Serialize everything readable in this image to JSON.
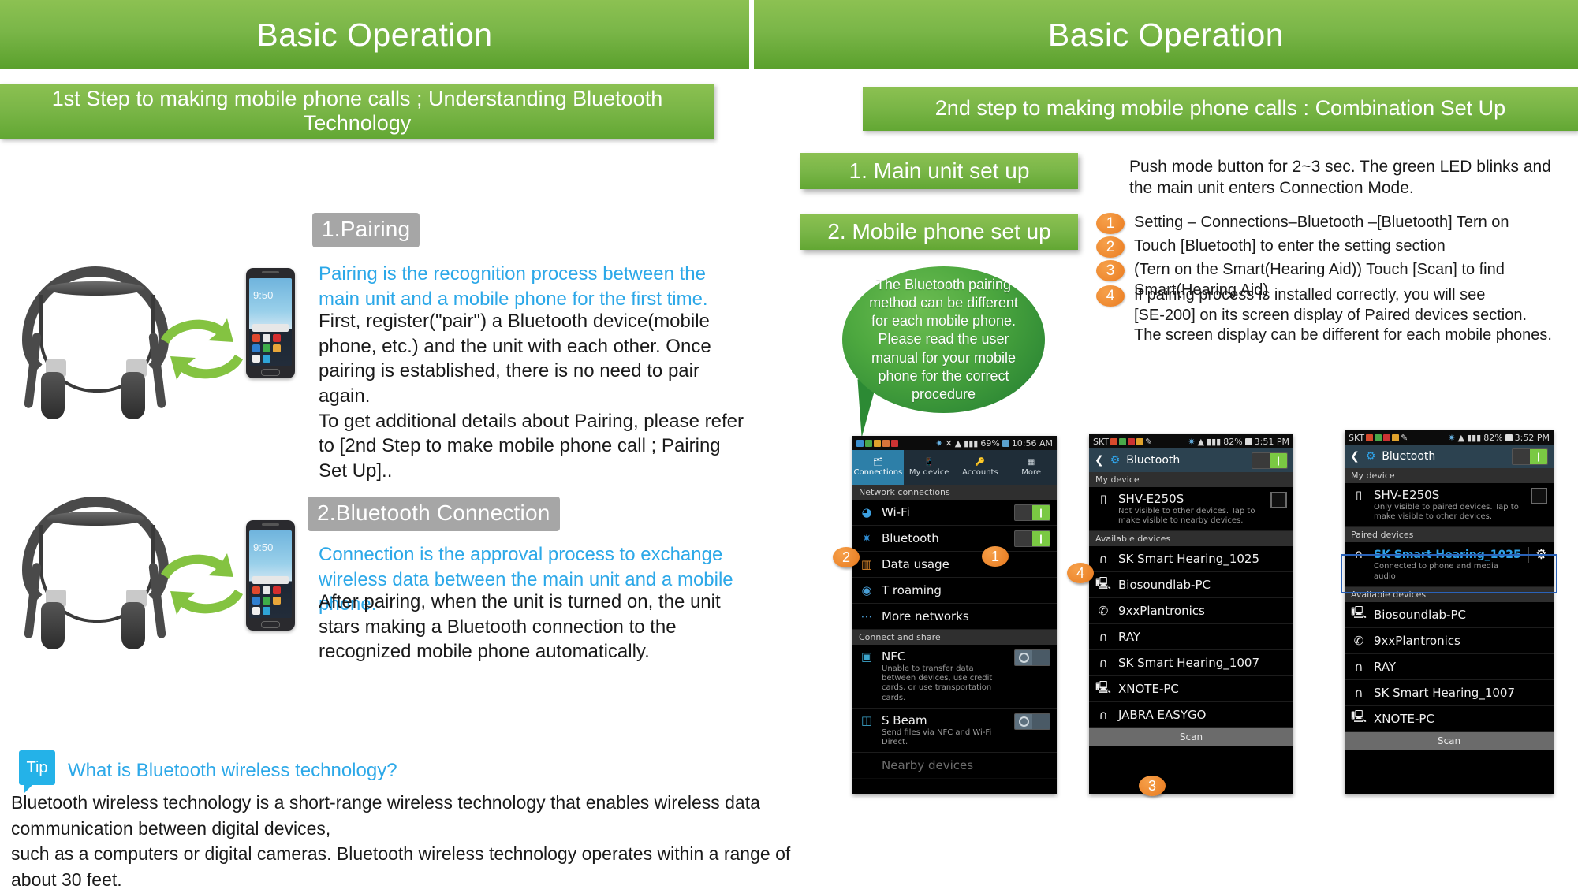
{
  "banners": {
    "left_title": "Basic Operation",
    "right_title": "Basic Operation",
    "left_subtitle": "1st Step to making mobile phone calls ; Understanding Bluetooth Technology",
    "right_subtitle": "2nd step to making mobile phone calls : Combination Set Up"
  },
  "left": {
    "section1": {
      "tag": "1.Pairing",
      "highlight": "Pairing is the recognition process between the main unit and a mobile phone for the first time.",
      "body": "First, register(\"pair\") a Bluetooth device(mobile phone, etc.) and the unit with each other. Once pairing is established, there is no need to pair again.\nTo get additional details about Pairing, please refer to [2nd Step to make mobile phone call ; Pairing Set Up].."
    },
    "section2": {
      "tag": "2.Bluetooth Connection",
      "highlight": "Connection is the approval process to exchange wireless data between the main unit and a mobile phone.",
      "body": "After pairing, when the unit is turned on, the unit stars making a Bluetooth connection to the recognized mobile phone automatically."
    },
    "tip": {
      "badge": "Tip",
      "question": "What is Bluetooth wireless technology?",
      "body": "Bluetooth wireless technology is a short-range wireless technology that enables wireless data communication between digital devices,\nsuch as a computers or digital cameras. Bluetooth wireless technology operates within a range of about 30 feet."
    },
    "phone_time": "9:50"
  },
  "right": {
    "button1": "1. Main unit set up",
    "button2": "2. Mobile phone set up",
    "note1": "Push mode button for 2~3 sec. The green LED blinks and the main unit enters Connection Mode.",
    "steps": [
      {
        "num": "1",
        "text": "Setting – Connections–Bluetooth –[Bluetooth] Tern on"
      },
      {
        "num": "2",
        "text": "Touch [Bluetooth] to enter the setting section"
      },
      {
        "num": "3",
        "text": "(Tern on the Smart(Hearing Aid)) Touch [Scan] to find Smart(Hearing Aid)"
      },
      {
        "num": "4",
        "text": "If pairing process is installed correctly, you will see\n[SE-200] on its screen display of Paired devices section.\nThe screen display can be different for each mobile phones."
      }
    ],
    "bubble": "The Bluetooth pairing method can be different for each mobile phone. Please read the user manual for your mobile phone for the correct procedure",
    "floating_badges": [
      {
        "num": "2"
      },
      {
        "num": "1"
      },
      {
        "num": "4"
      },
      {
        "num": "3"
      }
    ]
  },
  "phone1": {
    "status": {
      "battery": "69%",
      "time": "10:56 AM"
    },
    "tabs": [
      {
        "label": "Connections",
        "icon": "connections-icon",
        "active": true
      },
      {
        "label": "My device",
        "icon": "device-icon",
        "active": false
      },
      {
        "label": "Accounts",
        "icon": "key-icon",
        "active": false
      },
      {
        "label": "More",
        "icon": "more-icon",
        "active": false
      }
    ],
    "section1_header": "Network connections",
    "rows1": [
      {
        "label": "Wi-Fi",
        "icon": "wifi-icon",
        "toggle": "on"
      },
      {
        "label": "Bluetooth",
        "icon": "bluetooth-icon",
        "toggle": "on"
      },
      {
        "label": "Data usage",
        "icon": "chart-icon",
        "toggle": "none"
      },
      {
        "label": "T roaming",
        "icon": "globe-icon",
        "toggle": "none"
      },
      {
        "label": "More networks",
        "icon": "dots-icon",
        "toggle": "none"
      }
    ],
    "section2_header": "Connect and share",
    "rows2": [
      {
        "label": "NFC",
        "sub": "Unable to transfer data between devices, use credit cards, or use transportation cards.",
        "icon": "nfc-icon",
        "toggle": "off"
      },
      {
        "label": "S Beam",
        "sub": "Send files via NFC and Wi-Fi Direct.",
        "icon": "sbeam-icon",
        "toggle": "off"
      }
    ],
    "cut_row": "Nearby devices"
  },
  "phone2": {
    "status": {
      "carrier": "SKT",
      "battery": "82%",
      "time": "3:51 PM"
    },
    "title": "Bluetooth",
    "toggle": "on",
    "my_device_header": "My device",
    "my_device": {
      "name": "SHV-E250S",
      "sub": "Not visible to other devices. Tap to make visible to nearby devices."
    },
    "available_header": "Available devices",
    "available": [
      {
        "name": "SK Smart Hearing_1025",
        "icon": "headset-icon"
      },
      {
        "name": "Biosoundlab-PC",
        "icon": "computer-icon"
      },
      {
        "name": "9xxPlantronics",
        "icon": "phone-icon"
      },
      {
        "name": "RAY",
        "icon": "headset-icon"
      },
      {
        "name": "SK Smart Hearing_1007",
        "icon": "headset-icon"
      },
      {
        "name": "XNOTE-PC",
        "icon": "computer-icon"
      },
      {
        "name": "JABRA EASYGO",
        "icon": "headset-icon"
      }
    ],
    "scan": "Scan"
  },
  "phone3": {
    "status": {
      "carrier": "SKT",
      "battery": "82%",
      "time": "3:52 PM"
    },
    "title": "Bluetooth",
    "toggle": "on",
    "my_device_header": "My device",
    "my_device": {
      "name": "SHV-E250S",
      "sub": "Only visible to paired devices. Tap to make visible to other devices."
    },
    "paired_header": "Paired devices",
    "paired": {
      "name": "SK Smart Hearing_1025",
      "sub": "Connected to phone and media audio",
      "icon": "headset-icon",
      "settings_icon": "gear-icon"
    },
    "available_header": "Available devices",
    "available": [
      {
        "name": "Biosoundlab-PC",
        "icon": "computer-icon"
      },
      {
        "name": "9xxPlantronics",
        "icon": "phone-icon"
      },
      {
        "name": "RAY",
        "icon": "headset-icon"
      },
      {
        "name": "SK Smart Hearing_1007",
        "icon": "headset-icon"
      },
      {
        "name": "XNOTE-PC",
        "icon": "computer-icon"
      }
    ],
    "scan": "Scan"
  },
  "colors": {
    "green": "#7ab648",
    "blue_text": "#2ca8e8",
    "orange": "#e8791d",
    "grey_tag": "#a6a6a6",
    "tip_blue": "#24b2e8"
  }
}
